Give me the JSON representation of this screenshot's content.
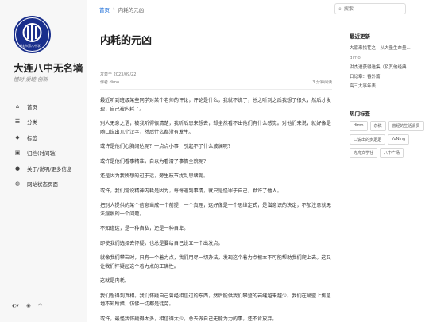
{
  "site": {
    "logo_text": "大连市第八中学",
    "title": "大连八中无名墙",
    "subtitle": "懂时 爱睦 创新"
  },
  "nav": [
    {
      "label": "首页",
      "icon": "home-icon"
    },
    {
      "label": "分类",
      "icon": "list-icon"
    },
    {
      "label": "标签",
      "icon": "tag-icon"
    },
    {
      "label": "归档(时间轴)",
      "icon": "archive-icon"
    },
    {
      "label": "关于/说明/更多信息",
      "icon": "info-icon"
    },
    {
      "label": "网站状态页面",
      "icon": "globe-icon"
    }
  ],
  "footer_icons": [
    "theme-toggle-icon",
    "github-icon",
    "rss-icon"
  ],
  "breadcrumb": {
    "home": "首页",
    "sep": "›",
    "current": "内耗的元凶"
  },
  "search": {
    "placeholder": "搜索..."
  },
  "article": {
    "title": "内耗的元凶",
    "date": "发表于 2023/09/22",
    "author": "作者 dimo",
    "read_time": "3 分钟阅读",
    "paragraphs": [
      "最近听到班级某些同学对某个老师的评论，评论是什么，我就不说了，总之听到之后我想了很久，然后才发现，自己被内耗了。",
      "别人无意之语，被我听得很清楚，我听后思来想去，却全然看不出他们有什么感觉。对他们来说，就好像是随口说出几个汉字，然后什么都没有发生。",
      "或许是他们心胸阔达呢？一点点小事，引起不了什么波澜呢？",
      "或许是他们看事精准，自以为看清了事情全貌呢？",
      "还是因为我所想的过于远，旁生枝节扰乱思绪呢。",
      "或许，我们常说精神内耗是因为，每每遇到事情，就只是怪罪于自己，默许了他人。",
      "把别人提供的某个信息当成一个前提，一个真理，这好像是一个思维定式，是潜意识的决定，不加注意就无法摆脱的一个问题。",
      "不知道这，是一种自私，还是一种自卑。",
      "即使我们选择去怀疑，也总是要给自己设立一个出发点。",
      "就像我们攀岩时，只有一个着力点，我们用尽一切办法，发现这个着力点根本不可能帮助我们爬上去。这又让我们怀疑起这个着力点的正确性。",
      "这就是内耗。",
      "我们想得到真相。我们怀疑自己曾经相信过的东西，然后能供我们攀登的岩缝越来越少。我们在峭壁上焦急地不知所措，仿佛一切都是徒劳。",
      "或许，最怪我怀疑得太多，相信得太少。总去做自己无能为力的事，还不肯放弃。"
    ]
  },
  "recent": {
    "heading": "最近更新",
    "items": [
      {
        "title": "大家来找茬之：从大量生命量...",
        "muted": false
      },
      {
        "title": "dimo",
        "muted": true
      },
      {
        "title": "洪杰进获得选集（及其他经典...",
        "muted": false
      },
      {
        "title": "日记章：番外篇",
        "muted": false
      },
      {
        "title": "高三大事年表",
        "muted": false
      }
    ]
  },
  "tags": {
    "heading": "热门标签",
    "items": [
      "dimo",
      "杂稿",
      "曾经的生活丢员",
      "口说出的步足足",
      "YuNing",
      "方舟文学社",
      "八中广场"
    ]
  }
}
